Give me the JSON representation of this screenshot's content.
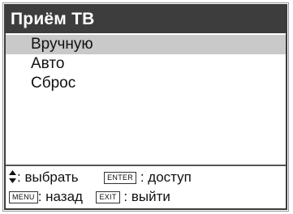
{
  "title": "Приём ТВ",
  "menu": {
    "items": [
      {
        "label": "Вручную",
        "selected": true
      },
      {
        "label": "Авто",
        "selected": false
      },
      {
        "label": "Сброс",
        "selected": false
      }
    ]
  },
  "footer": {
    "select_icon": "up-down-arrows-icon",
    "select_text": ": выбрать",
    "enter_key": "ENTER",
    "enter_text": ": доступ",
    "menu_key": "MENU",
    "menu_text": ": назад",
    "exit_key": "EXIT",
    "exit_text": ": выйти"
  },
  "colors": {
    "title_bg": "#3d3d3d",
    "selected_bg": "#c9c9c9",
    "text": "#111111"
  }
}
